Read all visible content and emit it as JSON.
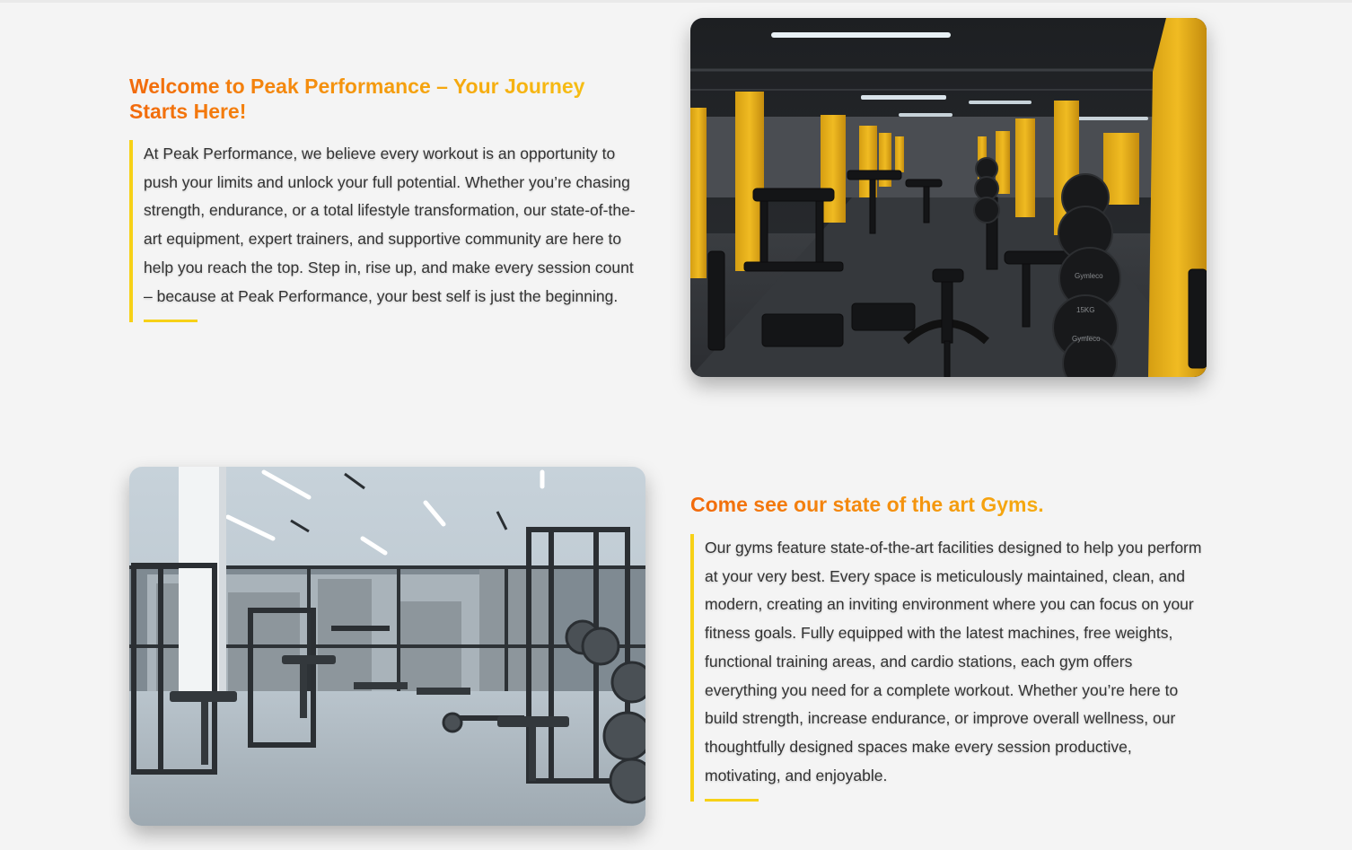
{
  "section_one": {
    "heading": "Welcome to Peak Performance – Your Journey Starts Here!",
    "body": "At Peak Performance, we believe every workout is an opportunity to push your limits and unlock your full potential. Whether you’re chasing strength, endurance, or a total lifestyle transformation, our state-of-the-art equipment, expert trainers, and supportive community are here to help you reach the top. Step in, rise up, and make every session count – because at Peak Performance, your best self is just the beginning."
  },
  "section_two": {
    "heading": "Come see our state of the art Gyms.",
    "body": "Our gyms feature state-of-the-art facilities designed to help you perform at your very best. Every space is meticulously maintained, clean, and modern, creating an inviting environment where you can focus on your fitness goals. Fully equipped with the latest machines, free weights, functional training areas, and cardio stations, each gym offers everything you need for a complete workout. Whether you’re here to build strength, increase endurance, or improve overall wellness, our thoughtfully designed spaces make every session productive, motivating, and enjoyable."
  },
  "theme": {
    "heading_gradient_start": "#f26a0c",
    "heading_gradient_end": "#f7c515",
    "accent_bar": "#f7d117",
    "body_text": "#333333",
    "background": "#f4f4f4"
  }
}
